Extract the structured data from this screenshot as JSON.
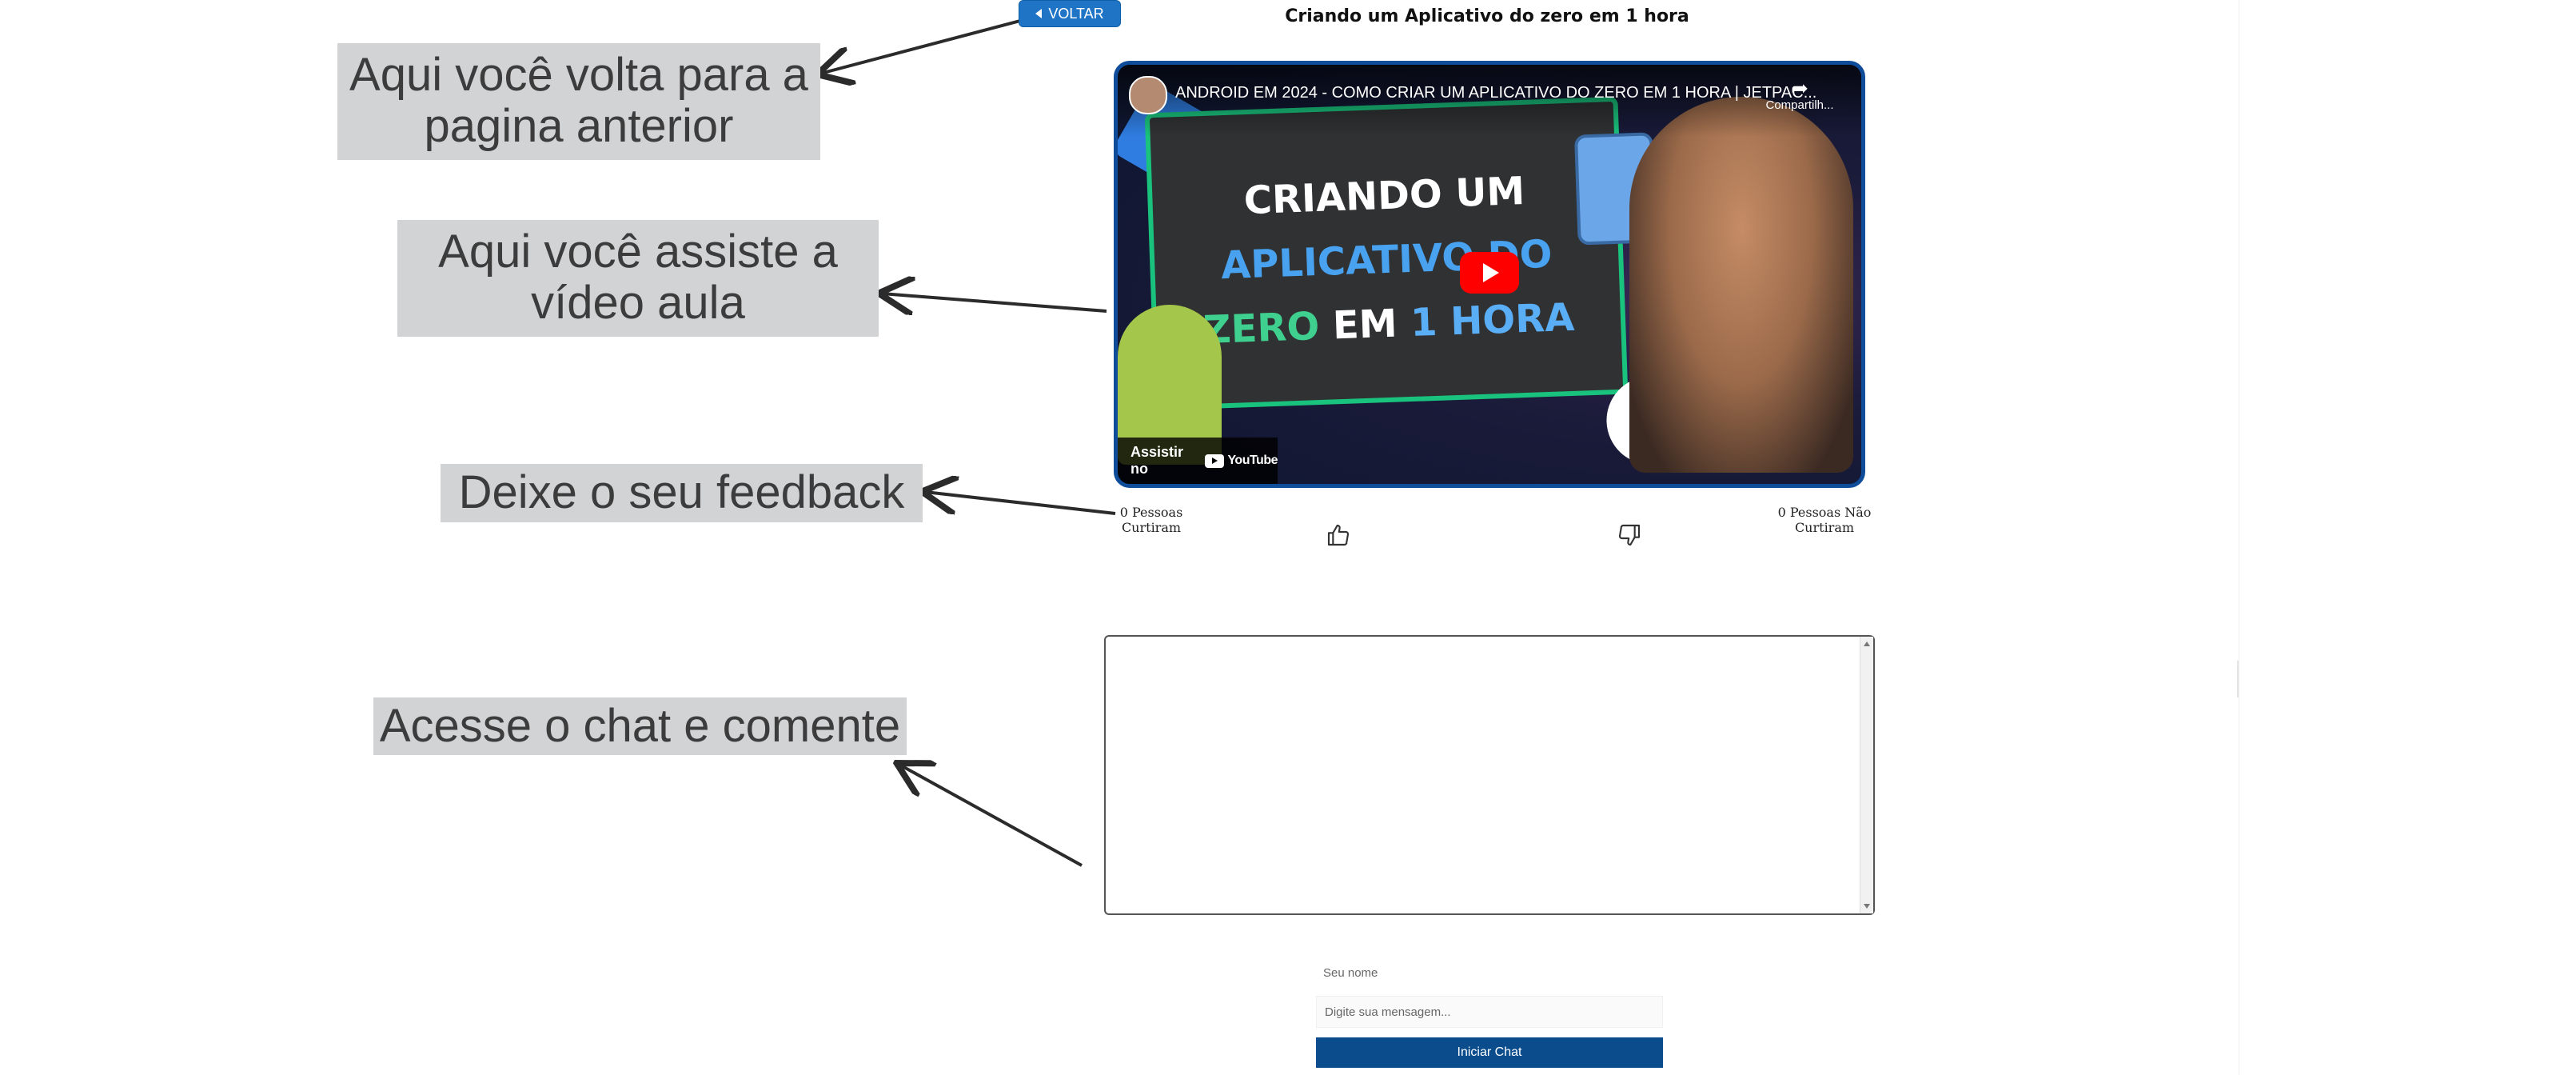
{
  "header": {
    "back_label": "VOLTAR",
    "title": "Criando um Aplicativo do zero em 1 hora"
  },
  "callouts": {
    "back": "Aqui você volta para a pagina anterior",
    "video": "Aqui você assiste a vídeo aula",
    "feedback": "Deixe o seu feedback",
    "chat": "Acesse o chat e comente"
  },
  "video": {
    "title": "ANDROID EM 2024 - COMO CRIAR UM APLICATIVO DO ZERO EM 1 HORA | JETPAC...",
    "share_label": "Compartilh...",
    "watch_on_label": "Assistir no",
    "youtube_wordmark": "YouTube",
    "thumbnail_text": {
      "line1": "CRIANDO UM",
      "line2": "APLICATIVO DO",
      "line3_a": "ZERO",
      "line3_b": "EM",
      "line3_c": "1 HORA"
    }
  },
  "feedback": {
    "likes_text": "0 Pessoas Curtiram",
    "dislikes_text": "0 Pessoas Não Curtiram"
  },
  "chat": {
    "name_label": "Seu nome",
    "message_placeholder": "Digite sua mensagem...",
    "start_button": "Iniciar Chat"
  },
  "colors": {
    "accent": "#1f74c6",
    "primary_button": "#0b4c8c",
    "callout_bg": "#d2d3d5",
    "youtube_red": "#ff0000"
  }
}
